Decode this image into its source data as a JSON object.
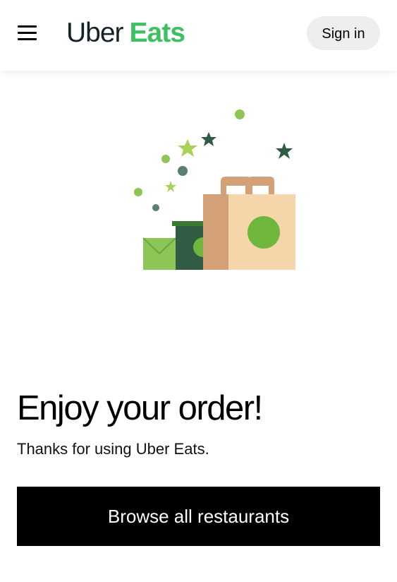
{
  "header": {
    "menu_icon": "hamburger-menu-icon",
    "logo_brand": "Uber",
    "logo_product": "Eats",
    "sign_in_label": "Sign in"
  },
  "illustration": {
    "icon": "order-bags-illustration",
    "colors": {
      "light_green": "#8dc557",
      "bright_green": "#6fb73c",
      "dark_green": "#2f5c42",
      "slate": "#5a7f6d",
      "kraft": "#f5d5aa",
      "kraft_dark": "#d4a078"
    }
  },
  "main": {
    "headline": "Enjoy your order!",
    "subtext": "Thanks for using Uber Eats.",
    "cta_label": "Browse all restaurants"
  },
  "colors": {
    "brand_green": "#3fc060",
    "logo_dark": "#142328",
    "button_black": "#000000",
    "signin_bg": "#eeeeee"
  }
}
